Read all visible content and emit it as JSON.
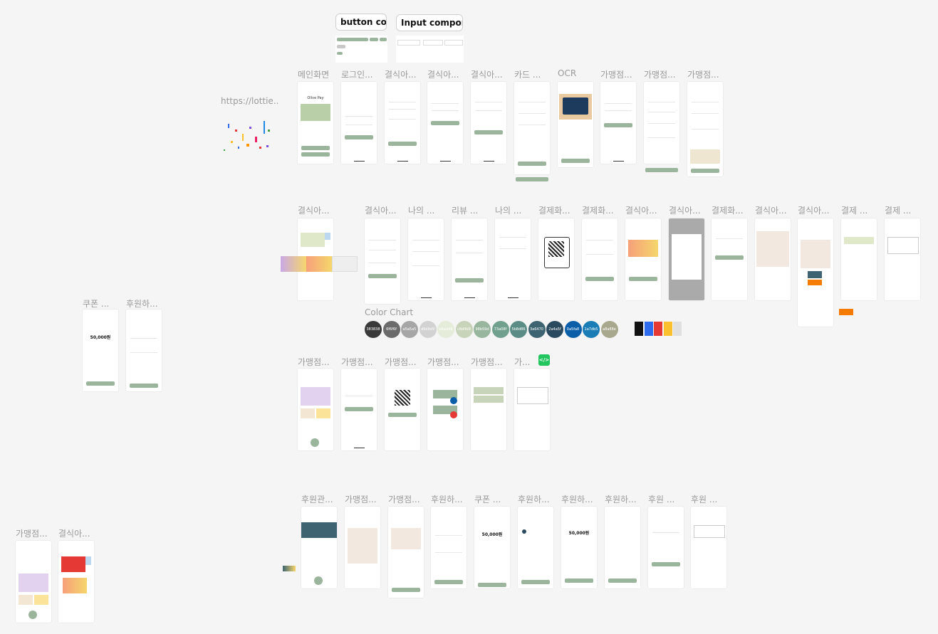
{
  "components": {
    "button_title": "button co...",
    "input_title": "Input compon..."
  },
  "lottie_label": "https://lottie...",
  "row1": [
    {
      "label": "메인화면",
      "app_title": "Olive Pay"
    },
    {
      "label": "로그인..."
    },
    {
      "label": "결식아..."
    },
    {
      "label": "결식아..."
    },
    {
      "label": "결식아..."
    },
    {
      "label": "카드 ..."
    },
    {
      "label": "OCR"
    },
    {
      "label": "가맹점..."
    },
    {
      "label": "가맹점..."
    },
    {
      "label": "가맹점..."
    }
  ],
  "row2": [
    {
      "label": "결식아..."
    },
    {
      "label": "결식아..."
    },
    {
      "label": "나의 ..."
    },
    {
      "label": "리뷰 ..."
    },
    {
      "label": "나의 ..."
    },
    {
      "label": "결제화..."
    },
    {
      "label": "결제화..."
    },
    {
      "label": "결식아..."
    },
    {
      "label": "결식아..."
    },
    {
      "label": "결제화..."
    },
    {
      "label": "결식아..."
    },
    {
      "label": "결식아..."
    },
    {
      "label": "결제 ..."
    },
    {
      "label": "결제 ..."
    }
  ],
  "left_pair": [
    {
      "label": "쿠폰 ...",
      "amount": "50,000원"
    },
    {
      "label": "후원하..."
    }
  ],
  "color_chart": {
    "title": "Color Chart",
    "swatches": [
      {
        "hex": "#3a3a3a",
        "code": "383838"
      },
      {
        "hex": "#6b6b6b",
        "code": "6f6f6f"
      },
      {
        "hex": "#a6a6a6",
        "code": "a5a5a5"
      },
      {
        "hex": "#d2d2d2",
        "code": "d9d9d9"
      },
      {
        "hex": "#e5ecd9",
        "code": "e8edd9"
      },
      {
        "hex": "#c8d4b9",
        "code": "c8d4b9"
      },
      {
        "hex": "#98b59d",
        "code": "98b59d"
      },
      {
        "hex": "#72a08f",
        "code": "73a08f"
      },
      {
        "hex": "#5b8d86",
        "code": "5b8d86"
      },
      {
        "hex": "#3d6470",
        "code": "3a6470"
      },
      {
        "hex": "#2a4a5f",
        "code": "2a4a5f"
      },
      {
        "hex": "#0a5fa8",
        "code": "0a5fa8"
      },
      {
        "hex": "#1a7db5",
        "code": "1a7db5"
      },
      {
        "hex": "#a8a88e",
        "code": "a8a88e"
      }
    ],
    "strip": [
      "#111111",
      "#2d6bef",
      "#e53935",
      "#fbc02d",
      "#e0e0e0"
    ]
  },
  "row3": [
    {
      "label": "가맹점..."
    },
    {
      "label": "가맹점..."
    },
    {
      "label": "가맹점..."
    },
    {
      "label": "가맹점..."
    },
    {
      "label": "가맹점..."
    },
    {
      "label": "가..."
    }
  ],
  "code_icon": "</>",
  "row4": [
    {
      "label": "후원관..."
    },
    {
      "label": "가맹점..."
    },
    {
      "label": "가맹점..."
    },
    {
      "label": "후원하..."
    },
    {
      "label": "쿠폰 ...",
      "amount": "50,000원"
    },
    {
      "label": "후원하..."
    },
    {
      "label": "후원하...",
      "amount": "50,000원"
    },
    {
      "label": "후원하..."
    },
    {
      "label": "후원 ..."
    },
    {
      "label": "후원 ..."
    }
  ],
  "bottom_left": [
    {
      "label": "가맹점..."
    },
    {
      "label": "결식아..."
    }
  ]
}
